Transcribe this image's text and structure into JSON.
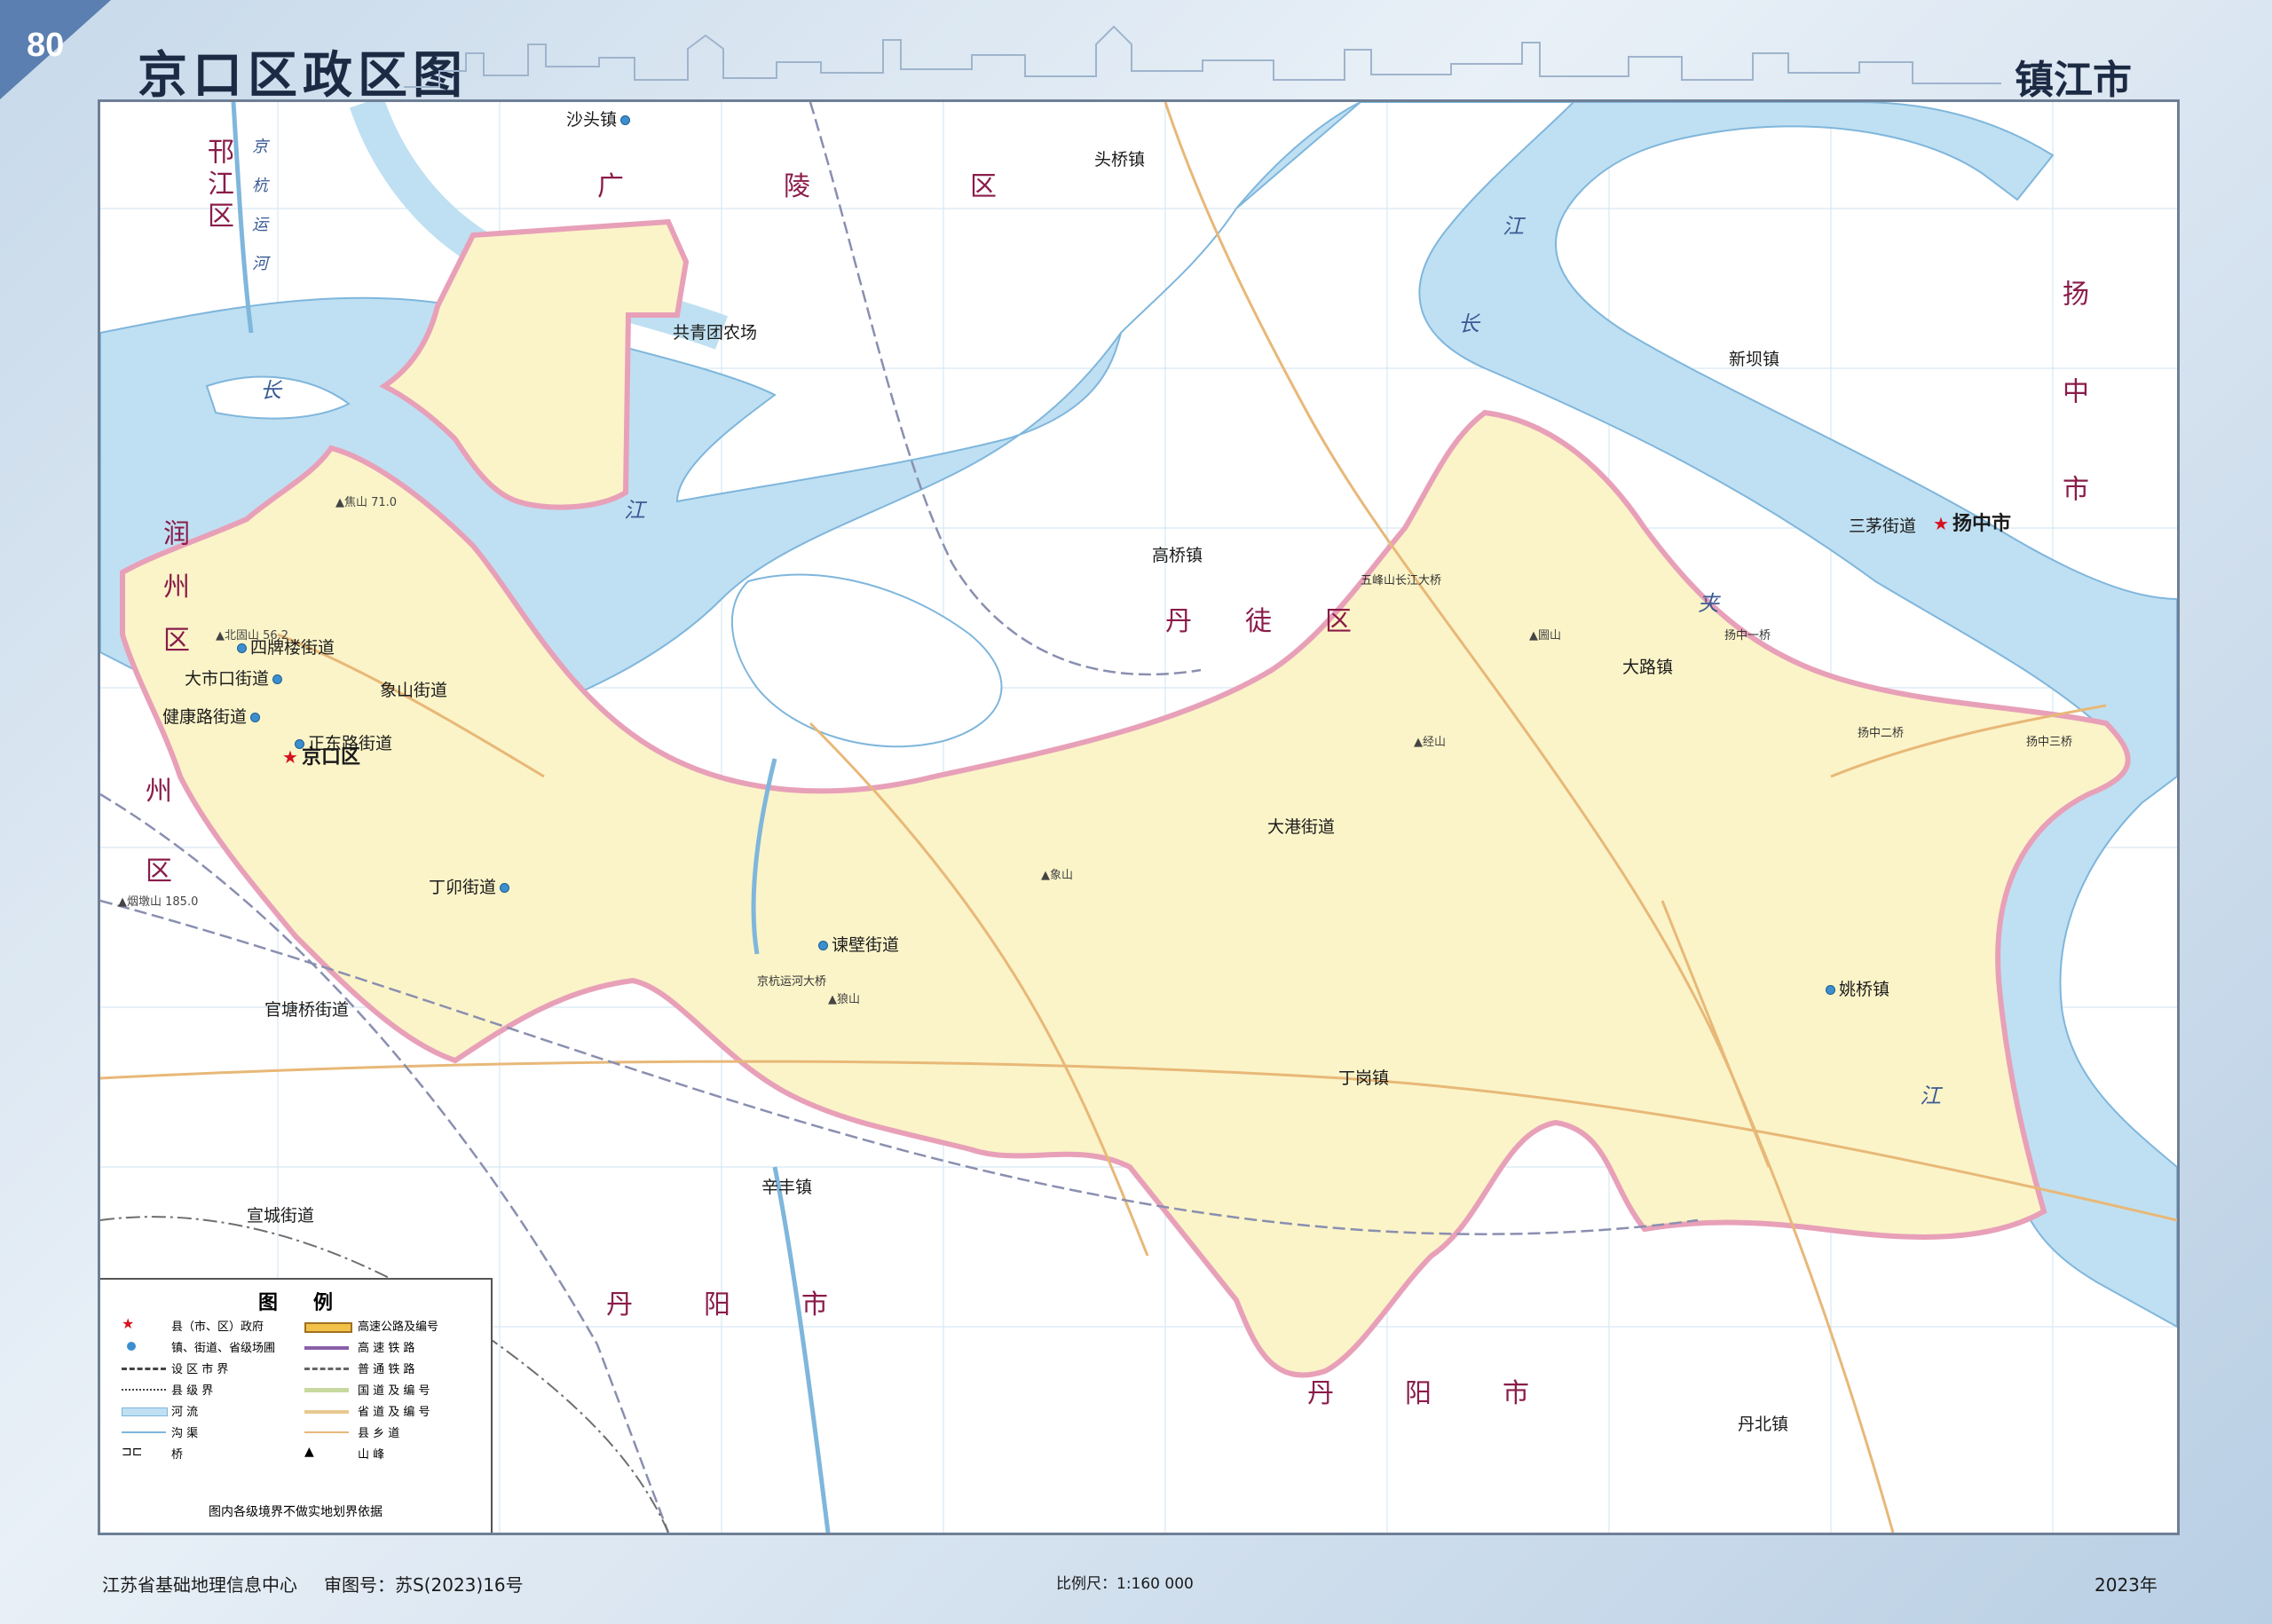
{
  "page_number": "80",
  "title": "京口区政区图",
  "city": "镇江市",
  "map": {
    "district_seat": "京口区",
    "streets": [
      "四牌楼街道",
      "大市口街道",
      "健康路街道",
      "正东路街道",
      "象山街道",
      "丁卯街道",
      "谏壁街道",
      "大港街道"
    ],
    "towns_in": [
      "大路镇",
      "姚桥镇",
      "丁岗镇"
    ],
    "farm": "共青团农场",
    "towns_out": [
      "沙头镇",
      "头桥镇",
      "高桥镇",
      "新坝镇",
      "三茅街道",
      "辛丰镇",
      "宣城街道",
      "官塘桥街道",
      "丹北镇"
    ],
    "county_seat_out": "扬中市",
    "area_labels": [
      "邗江区",
      "广陵区",
      "扬中市",
      "润州区",
      "丹徒区",
      "丹阳市",
      "州区",
      "丹徒区",
      "丹阳市"
    ],
    "rivers": [
      "长",
      "江",
      "夹",
      "江",
      "京杭运河",
      "长",
      "江"
    ],
    "bridges": [
      "五峰山长江大桥",
      "扬中一桥",
      "扬中二桥",
      "扬中三桥",
      "京杭运河大桥"
    ],
    "peaks": [
      "焦山 71.0",
      "北固山 56.2",
      "象山",
      "圌山",
      "经山",
      "狼山",
      "烟墩山 185.0"
    ]
  },
  "legend": {
    "title": "图例",
    "rows": [
      {
        "left": "县（市、区）政府",
        "right": "高速公路及编号"
      },
      {
        "left": "镇、街道、省级场圃",
        "right": "高 速 铁 路"
      },
      {
        "left": "设 区 市 界",
        "right": "普 通 铁 路"
      },
      {
        "left": "县 级 界",
        "right": "国 道 及 编 号"
      },
      {
        "left": "河 流",
        "right": "省 道 及 编 号"
      },
      {
        "left": "沟 渠",
        "right": "县 乡 道"
      },
      {
        "left": "桥",
        "right": "山 峰"
      }
    ],
    "note": "图内各级境界不做实地划界依据"
  },
  "footer": {
    "publisher": "江苏省基础地理信息中心",
    "approval": "审图号：苏S(2023)16号",
    "scale": "比例尺：1:160 000",
    "year": "2023年"
  },
  "colors": {
    "water": "#bfe0f2",
    "district": "#fbf4c8",
    "boundary": "#e8a0b8",
    "road": "#e8b878",
    "frame": "#6e7f95"
  }
}
